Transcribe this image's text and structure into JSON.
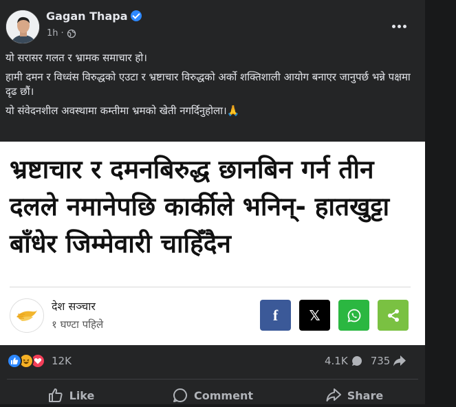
{
  "post": {
    "author": "Gagan Thapa",
    "time": "1h",
    "privacy_icon": "globe-icon",
    "text": {
      "line1": "यो सरासर गलत र भ्रामक समाचार हो।",
      "line2": "हामी दमन र विध्वंस विरुद्धको एउटा र भ्रष्टाचार विरुद्धको अर्को शक्तिशाली आयोग बनाएर जानुपर्छ भन्ने पक्षमा दृढ छौं।",
      "line3": "यो संवेदनशील अवस्थामा कम्तीमा भ्रमको खेती नगर्दिनुहोला।🙏"
    }
  },
  "card": {
    "headline": "भ्रष्टाचार र दमनबिरुद्ध छानबिन गर्न तीन दलले नमानेपछि कार्कीले भनिन्- हातखुट्टा बाँधेर जिम्मेवारी चाहिँदैन",
    "publisher": "देश सञ्चार",
    "published": "१ घण्टा पहिले",
    "share_buttons": {
      "facebook": "f",
      "x": "𝕏"
    }
  },
  "engagement": {
    "reaction_count": "12K",
    "comment_count": "4.1K",
    "share_count": "735"
  },
  "actions": {
    "like": "Like",
    "comment": "Comment",
    "share": "Share"
  },
  "colors": {
    "background": "#242526",
    "text": "#e4e6eb",
    "secondary_text": "#b0b3b8",
    "verified": "#2d88ff",
    "facebook_button": "#3b5998",
    "x_button": "#000000",
    "whatsapp_button": "#2bb741",
    "share_button": "#7ac142"
  }
}
